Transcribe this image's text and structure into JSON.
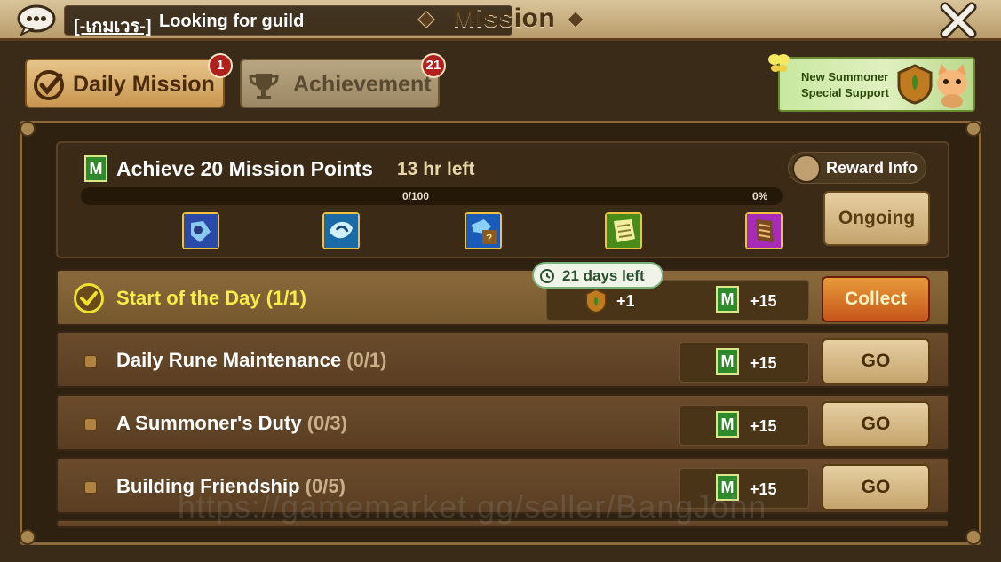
{
  "topbar": {
    "chat_tag": "[-เกมเวร-]",
    "chat_text": "Looking for guild",
    "title": "Mission"
  },
  "tabs": [
    {
      "label": "Daily Mission",
      "badge": "1",
      "active": true
    },
    {
      "label": "Achievement",
      "badge": "21",
      "active": false
    }
  ],
  "promo": {
    "line1": "New Summoner",
    "line2": "Special Support"
  },
  "summary": {
    "m_label": "M",
    "title": "Achieve 20 Mission Points",
    "time_left": "13 hr left",
    "reward_info_label": "Reward Info",
    "progress_text": "0/100",
    "progress_percent": "0%",
    "progress_fraction": 0,
    "status_button": "Ongoing",
    "reward_items": [
      {
        "name": "rune-scroll-blue",
        "color": "#4a6ad8"
      },
      {
        "name": "rune-scroll-cyan",
        "color": "#3a9ad8"
      },
      {
        "name": "rune-mystery",
        "color": "#3a6ac8"
      },
      {
        "name": "scroll-green",
        "color": "#7ac83a"
      },
      {
        "name": "scroll-purple",
        "color": "#c83ad8"
      }
    ]
  },
  "days_left": "21 days left",
  "missions": [
    {
      "name": "Start of the Day",
      "count": "(1/1)",
      "done": true,
      "extra_reward": "+1",
      "m_label": "M",
      "points": "+15",
      "button": "Collect"
    },
    {
      "name": "Daily Rune Maintenance",
      "count": "(0/1)",
      "done": false,
      "m_label": "M",
      "points": "+15",
      "button": "GO"
    },
    {
      "name": "A Summoner's Duty",
      "count": "(0/3)",
      "done": false,
      "m_label": "M",
      "points": "+15",
      "button": "GO"
    },
    {
      "name": "Building Friendship",
      "count": "(0/5)",
      "done": false,
      "m_label": "M",
      "points": "+15",
      "button": "GO"
    }
  ],
  "watermark": "https://gamemarket.gg/seller/BangJohn"
}
